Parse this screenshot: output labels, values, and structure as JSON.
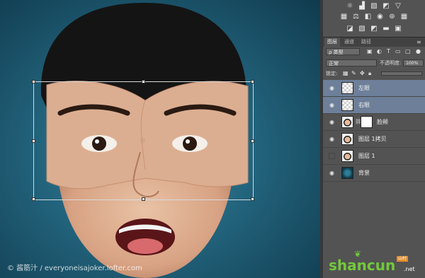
{
  "credit": {
    "text": "© 酱筋汁 / everyoneisajoker.lofter.com"
  },
  "adjustments": {
    "row1": [
      "brightness-icon",
      "levels-icon",
      "curves-icon",
      "exposure-icon",
      "vibrance-icon"
    ],
    "row2": [
      "hue-saturation-icon",
      "color-balance-icon",
      "black-white-icon",
      "photo-filter-icon",
      "channel-mixer-icon",
      "color-lookup-icon"
    ],
    "row3": [
      "invert-icon",
      "posterize-icon",
      "threshold-icon",
      "gradient-map-icon",
      "selective-color-icon"
    ]
  },
  "panel": {
    "tabs": [
      "图层",
      "通道",
      "路径"
    ],
    "filter_kind": "ρ 类型",
    "blend_mode": "正常",
    "opacity_label": "不透明度:",
    "opacity_value": "100%",
    "lock_label": "锁定:"
  },
  "layers": [
    {
      "name": "左眼",
      "selected": true,
      "thumb": "transparent"
    },
    {
      "name": "右眼",
      "selected": true,
      "thumb": "transparent"
    },
    {
      "name": "脸颊",
      "selected": false,
      "thumb": "face-with-mask"
    },
    {
      "name": "图层 1拷贝",
      "selected": false,
      "thumb": "face"
    },
    {
      "name": "图层 1",
      "selected": false,
      "thumb": "face",
      "hidden": true
    },
    {
      "name": "背景",
      "selected": false,
      "thumb": "background"
    }
  ],
  "watermark": {
    "text": "shancun",
    "sub": "山村",
    "domain": ".net"
  },
  "colors": {
    "canvas_bg": "#22637c",
    "panel_bg": "#535353",
    "selected_layer": "#6d7f99",
    "watermark_green": "#72c93b"
  }
}
